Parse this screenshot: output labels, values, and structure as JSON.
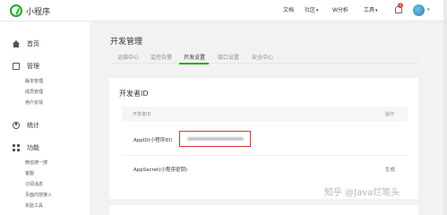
{
  "header": {
    "app_title": "小程序",
    "nav": [
      "文档",
      "社区",
      "W分析",
      "工具"
    ],
    "notification_count": "1"
  },
  "sidebar": {
    "groups": [
      {
        "label": "首页",
        "icon": "home-icon"
      },
      {
        "label": "管理",
        "icon": "manage-icon"
      },
      {
        "label": "统计",
        "icon": "stats-icon"
      },
      {
        "label": "功能",
        "icon": "grid-icon"
      }
    ],
    "manage_items": [
      "版本管理",
      "成员管理",
      "用户反馈"
    ],
    "feature_items": [
      "微信搜一搜",
      "客服",
      "订阅消息",
      "页面内容接入",
      "实验工具"
    ]
  },
  "main": {
    "title": "开发管理",
    "tabs": [
      "运维中心",
      "监控告警",
      "开发设置",
      "接口设置",
      "安全中心"
    ],
    "active_tab": "开发设置",
    "section_title": "开发者ID",
    "table": {
      "headers": [
        "开发者ID",
        "操作"
      ],
      "rows": [
        {
          "label": "AppID(小程序ID)",
          "action": ""
        },
        {
          "label": "AppSecret(小程序密钥)",
          "action": "生成"
        }
      ]
    }
  },
  "watermark": "知乎 @Java烂笔头",
  "colors": {
    "accent": "#1aad19",
    "highlight_border": "#d43c33"
  }
}
